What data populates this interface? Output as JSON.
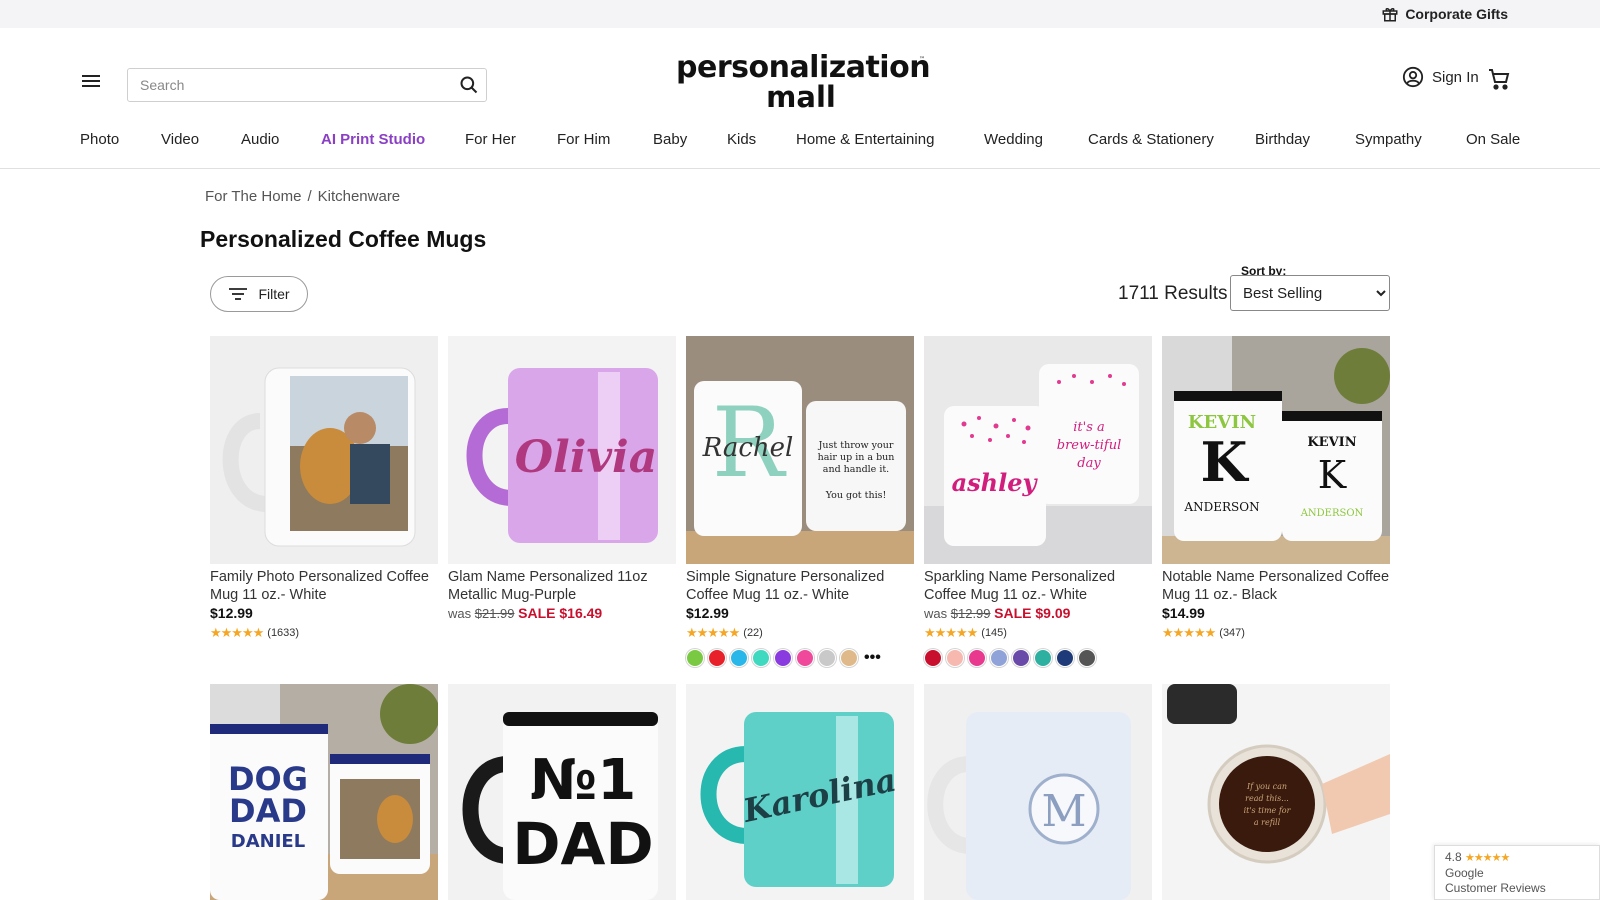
{
  "topbar": {
    "corporate_gifts": "Corporate Gifts"
  },
  "header": {
    "search_placeholder": "Search",
    "logo_line1": "personalization",
    "logo_line2": "mall",
    "logo_tm": "™",
    "sign_in": "Sign In"
  },
  "nav": {
    "items": [
      "Photo",
      "Video",
      "Audio",
      "AI Print Studio",
      "For Her",
      "For Him",
      "Baby",
      "Kids",
      "Home & Entertaining",
      "Wedding",
      "Cards & Stationery",
      "Birthday",
      "Sympathy",
      "On Sale"
    ]
  },
  "breadcrumb": {
    "items": [
      "For The Home",
      "Kitchenware"
    ],
    "separator": "/"
  },
  "page": {
    "title": "Personalized Coffee Mugs",
    "filter_label": "Filter",
    "results": "1711 Results",
    "sort_label": "Sort by:",
    "sort_value": "Best Selling"
  },
  "products": [
    {
      "name": "Family Photo Personalized Coffee Mug 11 oz.- White",
      "price": "$12.99",
      "stars": "★★★★★",
      "reviews": "(1633)"
    },
    {
      "name": "Glam Name Personalized 11oz Metallic Mug-Purple",
      "was_label": "was",
      "was_price": "$21.99",
      "sale_price": "SALE $16.49"
    },
    {
      "name": "Simple Signature Personalized Coffee Mug 11 oz.- White",
      "price": "$12.99",
      "stars": "★★★★★",
      "reviews": "(22)",
      "swatches": [
        "#7ac943",
        "#e8202a",
        "#29b6e8",
        "#3fd9c0",
        "#8a3be0",
        "#f0489a",
        "#c9c9c9",
        "#e0b98a"
      ],
      "more": "•••"
    },
    {
      "name": "Sparkling Name Personalized Coffee Mug 11 oz.- White",
      "was_label": "was",
      "was_price": "$12.99",
      "sale_price": "SALE $9.09",
      "stars": "★★★★★",
      "reviews": "(145)",
      "swatches": [
        "#c8102e",
        "#f7b8b0",
        "#e8398f",
        "#8fa3d8",
        "#6a4aa8",
        "#2db0a0",
        "#1e3a78",
        "#555555"
      ]
    },
    {
      "name": "Notable Name Personalized Coffee Mug 11 oz.- Black",
      "price": "$14.99",
      "stars": "★★★★★",
      "reviews": "(347)"
    }
  ],
  "mug_text": {
    "p2": "Olivia",
    "p3_letter": "R",
    "p3_name": "Rachel",
    "p3_quote1": "Just throw your",
    "p3_quote2": "hair up in a bun",
    "p3_quote3": "and handle it.",
    "p3_quote4": "You got this!",
    "p4_name": "ashley",
    "p4_quote1": "it's a",
    "p4_quote2": "brew-tiful",
    "p4_quote3": "day",
    "p5_name": "KEVIN",
    "p5_letter": "K",
    "p5_last": "ANDERSON",
    "p6_line1": "DOG",
    "p6_line2": "DAD",
    "p6_name": "DANIEL",
    "p7_line1": "№1",
    "p7_line2": "DAD",
    "p8": "Karolina",
    "p9": "M",
    "p10_1": "If you can",
    "p10_2": "read this...",
    "p10_3": "it's time for",
    "p10_4": "a refill"
  },
  "google_badge": {
    "score": "4.8",
    "stars": "★★★★★",
    "line1": "Google",
    "line2": "Customer Reviews"
  },
  "colors": {
    "accent_ai": "#8a3fc4",
    "sale": "#c8102e",
    "star": "#f5a623"
  }
}
